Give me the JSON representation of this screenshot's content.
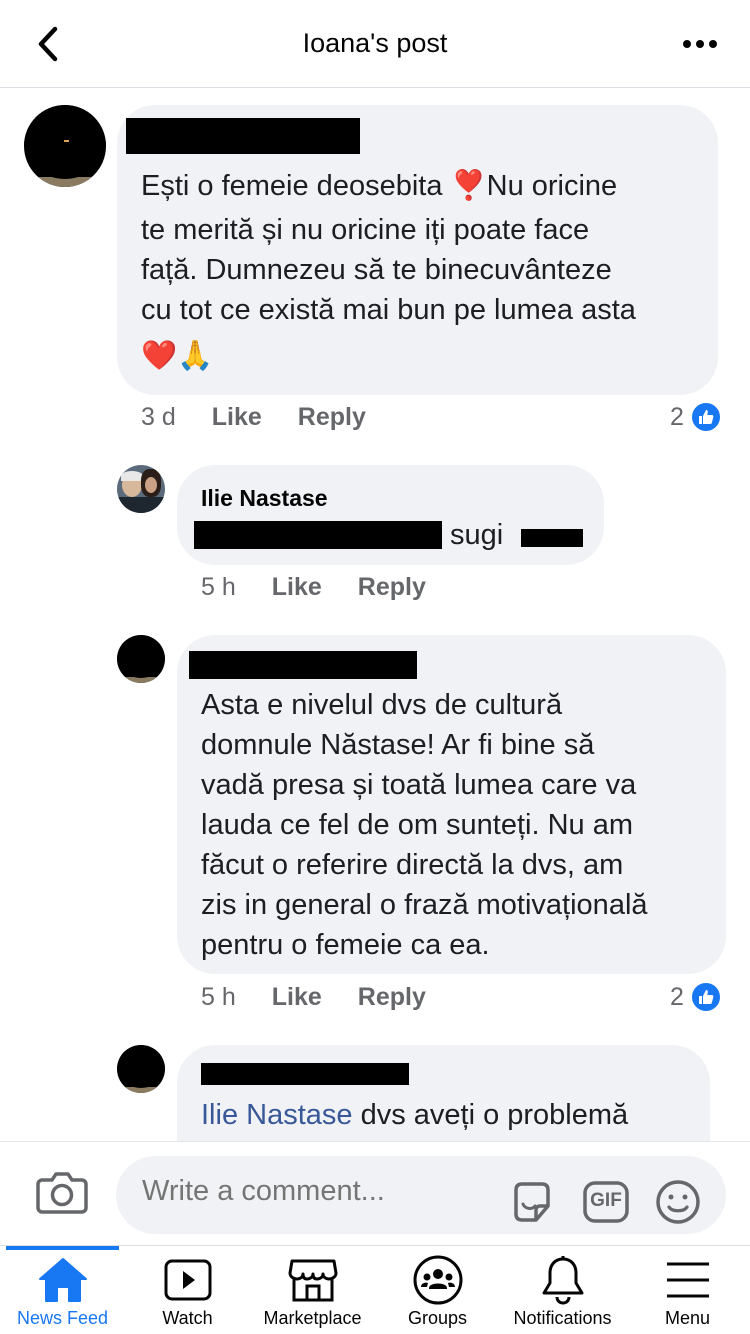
{
  "header": {
    "title": "Ioana's post",
    "back_icon": "chevron-left-icon",
    "more_icon": "more-horizontal-icon"
  },
  "comments": [
    {
      "text_lines": [
        "Ești o femeie deosebita ❣️Nu oricine",
        "te merită și nu oricine iți poate face",
        "față. Dumnezeu să te binecuvânteze",
        "cu tot ce există mai bun pe lumea asta",
        "❤️🙏"
      ],
      "time": "3 d",
      "like": "Like",
      "reply": "Reply",
      "reactions": "2"
    },
    {
      "author": "Ilie Nastase",
      "text": "sugi",
      "time": "5 h",
      "like": "Like",
      "reply": "Reply"
    },
    {
      "text_lines": [
        "Asta e nivelul dvs de cultură",
        "domnule Năstase! Ar fi bine să",
        "vadă presa și toată lumea care va",
        "lauda ce fel de om sunteți. Nu am",
        "făcut o referire directă la dvs, am",
        "zis in general o frază motivațională",
        "pentru o femeie ca ea."
      ],
      "time": "5 h",
      "like": "Like",
      "reply": "Reply",
      "reactions": "2"
    },
    {
      "mention": "Ilie Nastase",
      "text": " dvs aveți o problemă"
    }
  ],
  "composer": {
    "placeholder": "Write a comment...",
    "camera_icon": "camera-icon",
    "sticker_icon": "sticker-icon",
    "gif_label": "GIF",
    "emoji_icon": "emoji-icon"
  },
  "tabs": [
    {
      "label": "News Feed",
      "icon": "home-icon",
      "active": true
    },
    {
      "label": "Watch",
      "icon": "watch-icon"
    },
    {
      "label": "Marketplace",
      "icon": "marketplace-icon"
    },
    {
      "label": "Groups",
      "icon": "groups-icon"
    },
    {
      "label": "Notifications",
      "icon": "bell-icon"
    },
    {
      "label": "Menu",
      "icon": "menu-icon"
    }
  ],
  "colors": {
    "accent": "#1877f2",
    "bubble": "#f0f2f5",
    "meta_text": "#65676b",
    "mention": "#385898"
  }
}
